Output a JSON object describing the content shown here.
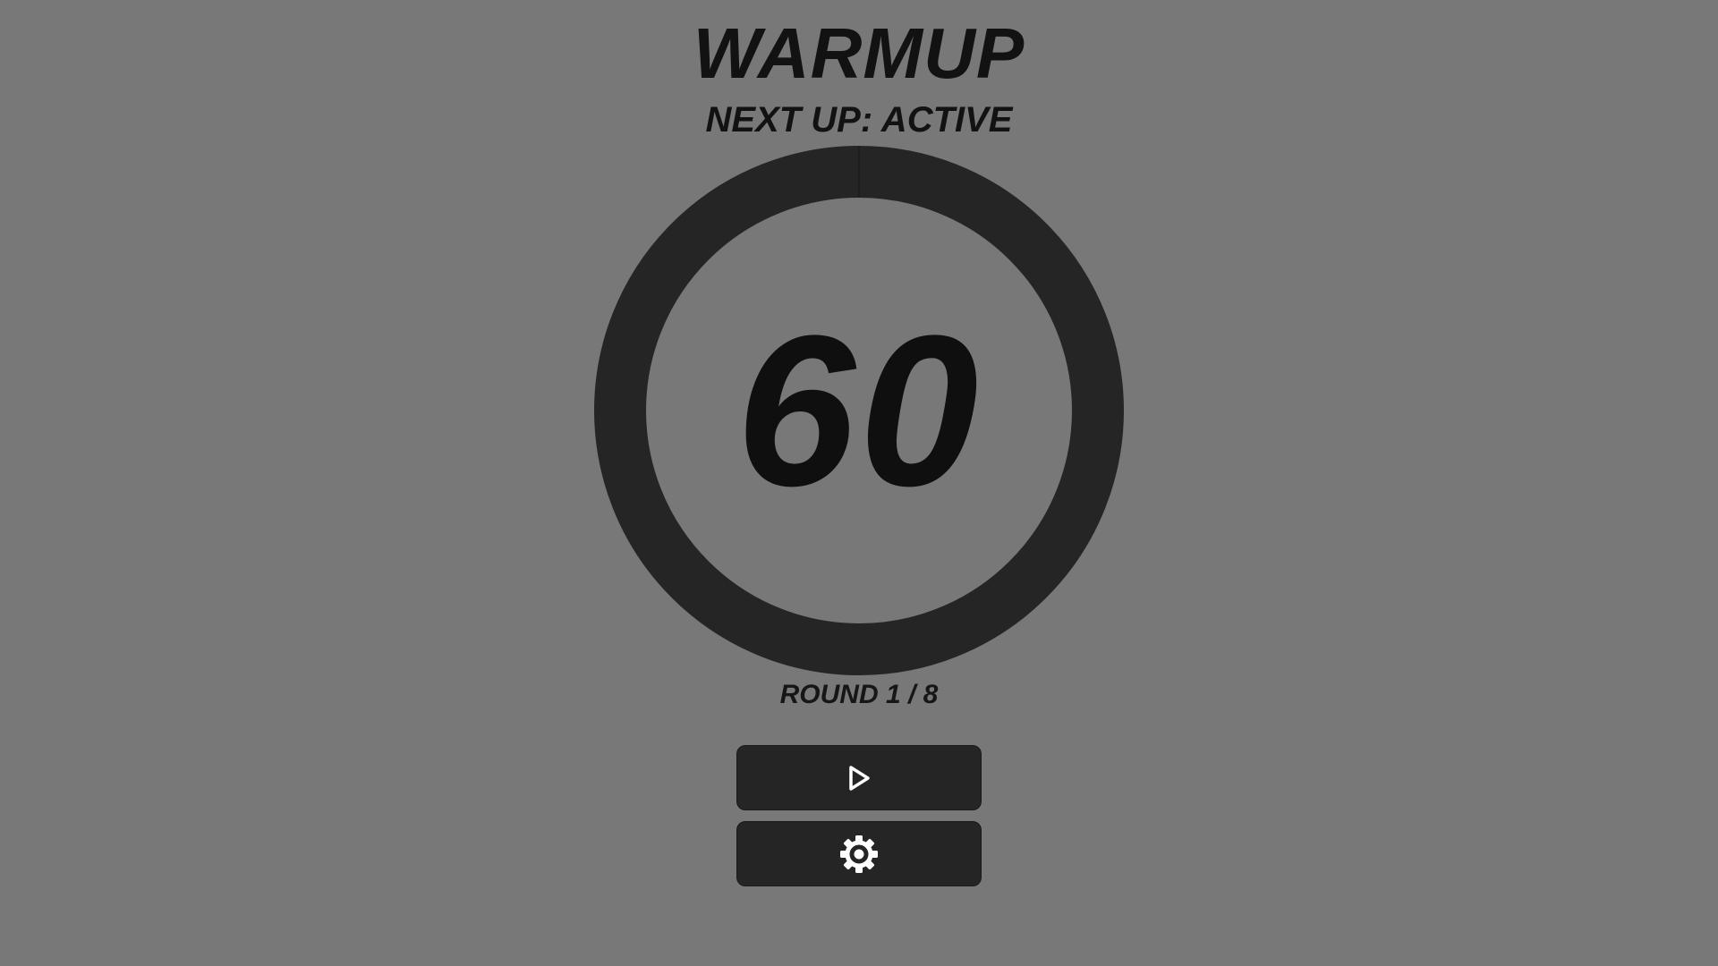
{
  "header": {
    "title": "WARMUP",
    "next_up": "NEXT UP: ACTIVE"
  },
  "timer": {
    "value": "60",
    "progress": 0.0
  },
  "round": {
    "label": "ROUND 1 / 8"
  },
  "controls": {
    "play_icon": "play-icon",
    "settings_icon": "gear-icon"
  },
  "colors": {
    "background": "#787878",
    "ring": "#252525",
    "button": "#252525",
    "text": "#121212",
    "icon": "#ffffff"
  }
}
